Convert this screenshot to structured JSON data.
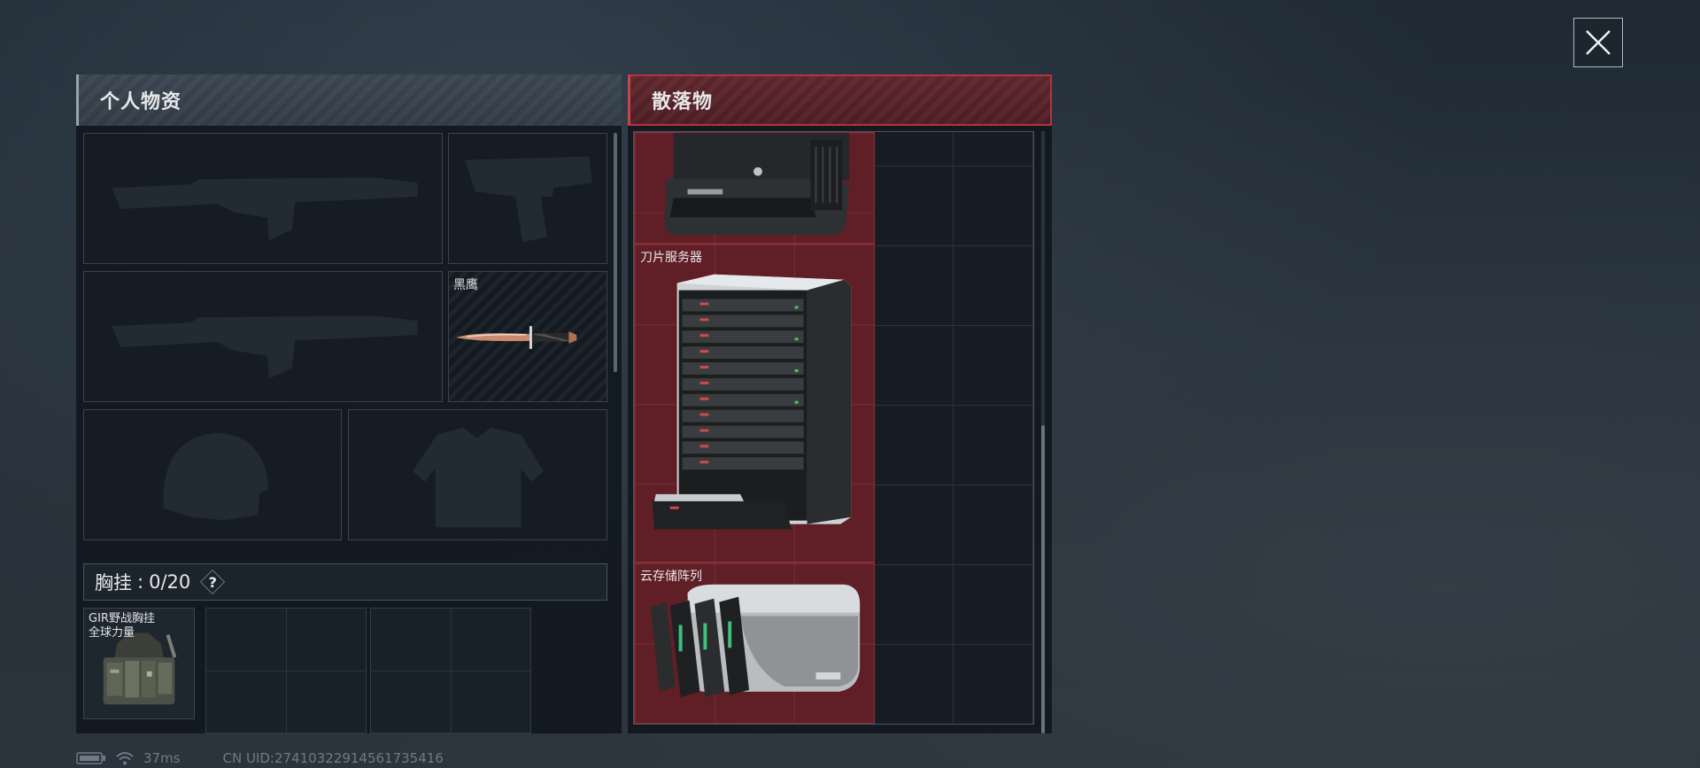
{
  "personal": {
    "title": "个人物资",
    "knife_label": "黑鹰",
    "chest_rig": {
      "label": "胸挂",
      "capacity": "0/20",
      "help": "?",
      "item_name": "GIR野战胸挂",
      "item_subtitle": "全球力量"
    }
  },
  "loot": {
    "title": "散落物",
    "items": [
      {
        "label": "刀片服务器"
      },
      {
        "label": "云存储阵列"
      }
    ]
  },
  "footer": {
    "ping": "37ms",
    "uid": "CN UID:27410322914561735416"
  },
  "icons": {
    "close": "close-icon",
    "battery": "battery-icon",
    "wifi": "wifi-icon"
  },
  "colors": {
    "loot_accent": "#b2343e",
    "loot_cell": "#702028",
    "panel_bg": "#10161d"
  }
}
